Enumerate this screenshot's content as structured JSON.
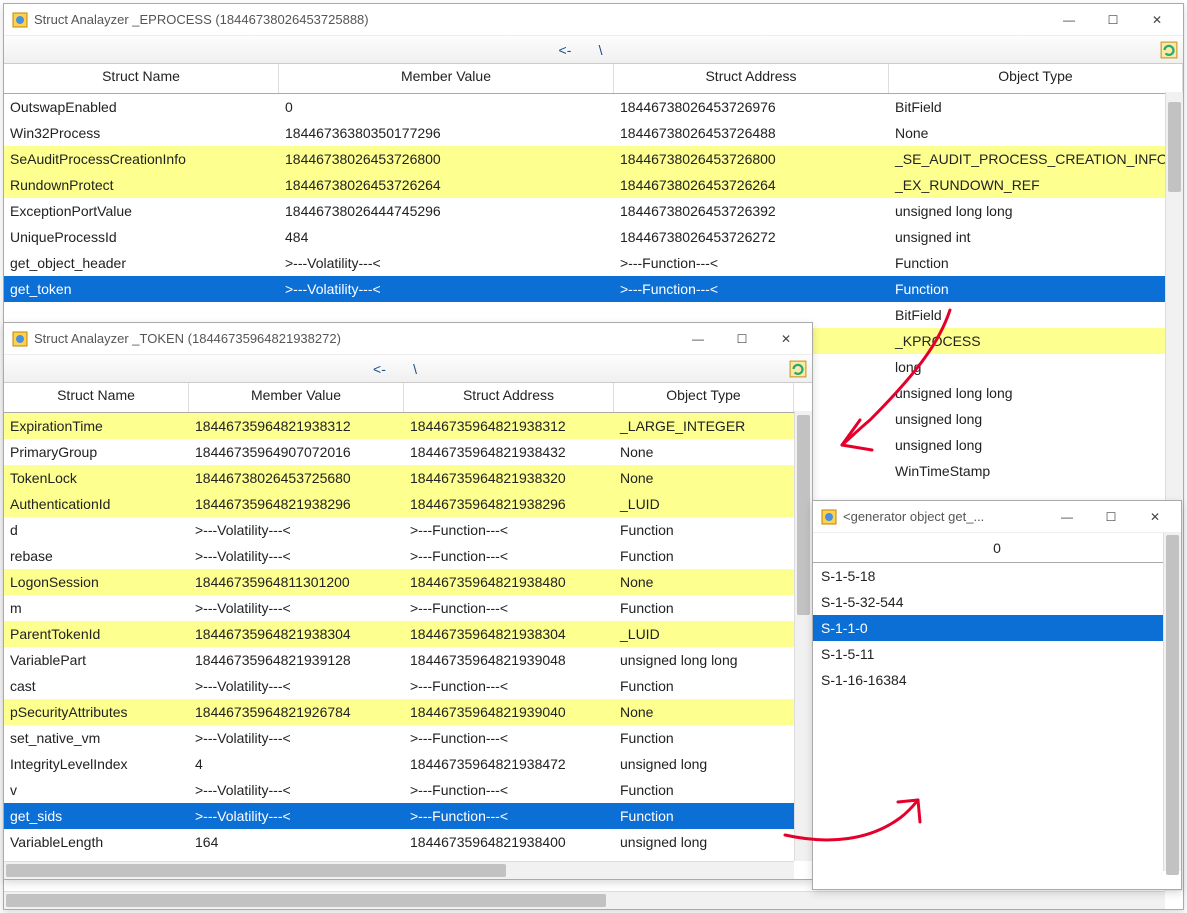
{
  "windows": {
    "main": {
      "title": "Struct Analayzer _EPROCESS (18446738026453725888)",
      "toolbar_back": "<-",
      "toolbar_sep": "\\",
      "headers": [
        "Struct Name",
        "Member Value",
        "Struct Address",
        "Object Type"
      ],
      "rows": [
        {
          "bg": "white",
          "cells": [
            "OutswapEnabled",
            "0",
            "18446738026453726976",
            "BitField"
          ]
        },
        {
          "bg": "white",
          "cells": [
            "Win32Process",
            "18446736380350177296",
            "18446738026453726488",
            "None"
          ]
        },
        {
          "bg": "yellow",
          "cells": [
            "SeAuditProcessCreationInfo",
            "18446738026453726800",
            "18446738026453726800",
            "_SE_AUDIT_PROCESS_CREATION_INFO"
          ]
        },
        {
          "bg": "yellow",
          "cells": [
            "RundownProtect",
            "18446738026453726264",
            "18446738026453726264",
            "_EX_RUNDOWN_REF"
          ]
        },
        {
          "bg": "white",
          "cells": [
            "ExceptionPortValue",
            "18446738026444745296",
            "18446738026453726392",
            "unsigned long long"
          ]
        },
        {
          "bg": "white",
          "cells": [
            "UniqueProcessId",
            "484",
            "18446738026453726272",
            "unsigned int"
          ]
        },
        {
          "bg": "white",
          "cells": [
            "get_object_header",
            ">---Volatility---<",
            ">---Function---<",
            "Function"
          ]
        },
        {
          "bg": "blue",
          "cells": [
            "get_token",
            ">---Volatility---<",
            ">---Function---<",
            "Function"
          ]
        },
        {
          "bg": "white",
          "cells": [
            "",
            "",
            "",
            "BitField"
          ]
        },
        {
          "bg": "yellow",
          "cells": [
            "",
            "",
            "",
            "_KPROCESS"
          ]
        },
        {
          "bg": "white",
          "cells": [
            "",
            "",
            "",
            "long"
          ]
        },
        {
          "bg": "white",
          "cells": [
            "",
            "",
            "",
            "unsigned long long"
          ]
        },
        {
          "bg": "white",
          "cells": [
            "",
            "",
            "",
            "unsigned long"
          ]
        },
        {
          "bg": "white",
          "cells": [
            "",
            "",
            "",
            "unsigned long"
          ]
        },
        {
          "bg": "white",
          "cells": [
            "",
            "",
            "",
            "WinTimeStamp"
          ]
        }
      ]
    },
    "sub": {
      "title": "Struct Analayzer _TOKEN (18446735964821938272)",
      "toolbar_back": "<-",
      "toolbar_sep": "\\",
      "headers": [
        "Struct Name",
        "Member Value",
        "Struct Address",
        "Object Type"
      ],
      "rows": [
        {
          "bg": "yellow",
          "cells": [
            "ExpirationTime",
            "18446735964821938312",
            "18446735964821938312",
            "_LARGE_INTEGER"
          ]
        },
        {
          "bg": "white",
          "cells": [
            "PrimaryGroup",
            "18446735964907072016",
            "18446735964821938432",
            "None"
          ]
        },
        {
          "bg": "yellow",
          "cells": [
            "TokenLock",
            "18446738026453725680",
            "18446735964821938320",
            "None"
          ]
        },
        {
          "bg": "yellow",
          "cells": [
            "AuthenticationId",
            "18446735964821938296",
            "18446735964821938296",
            "_LUID"
          ]
        },
        {
          "bg": "white",
          "cells": [
            "d",
            ">---Volatility---<",
            ">---Function---<",
            "Function"
          ]
        },
        {
          "bg": "white",
          "cells": [
            "rebase",
            ">---Volatility---<",
            ">---Function---<",
            "Function"
          ]
        },
        {
          "bg": "yellow",
          "cells": [
            "LogonSession",
            "18446735964811301200",
            "18446735964821938480",
            "None"
          ]
        },
        {
          "bg": "white",
          "cells": [
            "m",
            ">---Volatility---<",
            ">---Function---<",
            "Function"
          ]
        },
        {
          "bg": "yellow",
          "cells": [
            "ParentTokenId",
            "18446735964821938304",
            "18446735964821938304",
            "_LUID"
          ]
        },
        {
          "bg": "white",
          "cells": [
            "VariablePart",
            "18446735964821939128",
            "18446735964821939048",
            "unsigned long long"
          ]
        },
        {
          "bg": "white",
          "cells": [
            "cast",
            ">---Volatility---<",
            ">---Function---<",
            "Function"
          ]
        },
        {
          "bg": "yellow",
          "cells": [
            "pSecurityAttributes",
            "18446735964821926784",
            "18446735964821939040",
            "None"
          ]
        },
        {
          "bg": "white",
          "cells": [
            "set_native_vm",
            ">---Volatility---<",
            ">---Function---<",
            "Function"
          ]
        },
        {
          "bg": "white",
          "cells": [
            "IntegrityLevelIndex",
            "4",
            "18446735964821938472",
            "unsigned long"
          ]
        },
        {
          "bg": "white",
          "cells": [
            "v",
            ">---Volatility---<",
            ">---Function---<",
            "Function"
          ]
        },
        {
          "bg": "blue",
          "cells": [
            "get_sids",
            ">---Volatility---<",
            ">---Function---<",
            "Function"
          ]
        },
        {
          "bg": "white",
          "cells": [
            "VariableLength",
            "164",
            "18446735964821938400",
            "unsigned long"
          ]
        }
      ]
    },
    "gen": {
      "title": "<generator object get_...",
      "header": "0",
      "rows": [
        {
          "sel": false,
          "v": "S-1-5-18"
        },
        {
          "sel": false,
          "v": "S-1-5-32-544"
        },
        {
          "sel": true,
          "v": "S-1-1-0"
        },
        {
          "sel": false,
          "v": "S-1-5-11"
        },
        {
          "sel": false,
          "v": "S-1-16-16384"
        }
      ]
    }
  },
  "icons": {
    "minimize": "—",
    "maximize": "☐",
    "close": "✕"
  },
  "colors": {
    "highlight_yellow": "#fdff8e",
    "highlight_blue": "#0b6fd6",
    "annotation": "#e4002b"
  }
}
